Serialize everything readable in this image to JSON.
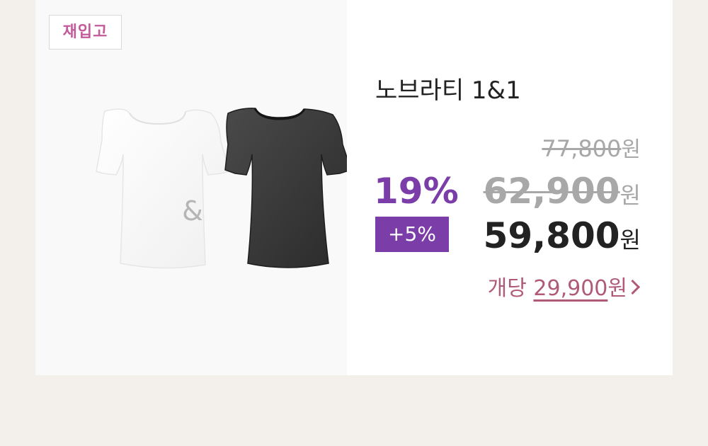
{
  "badge": {
    "label": "재입고"
  },
  "product": {
    "name": "노브라티 1&1",
    "separator": "&"
  },
  "discount": {
    "rate": "19%",
    "extra": "+5%"
  },
  "prices": {
    "original": "77,800",
    "original_unit": "원",
    "sale": "62,900",
    "sale_unit": "원",
    "final": "59,800",
    "final_unit": "원",
    "per_item_prefix": "개당",
    "per_item": "29,900",
    "per_item_unit": "원"
  },
  "icons": {
    "tshirt_white": "white-tshirt-image",
    "tshirt_black": "black-tshirt-image",
    "chevron": "chevron-right-icon"
  },
  "colors": {
    "accent_purple": "#7b3ea8",
    "accent_pink": "#c45a9b",
    "unit_price": "#b05a7a",
    "background": "#f3f0eb"
  }
}
